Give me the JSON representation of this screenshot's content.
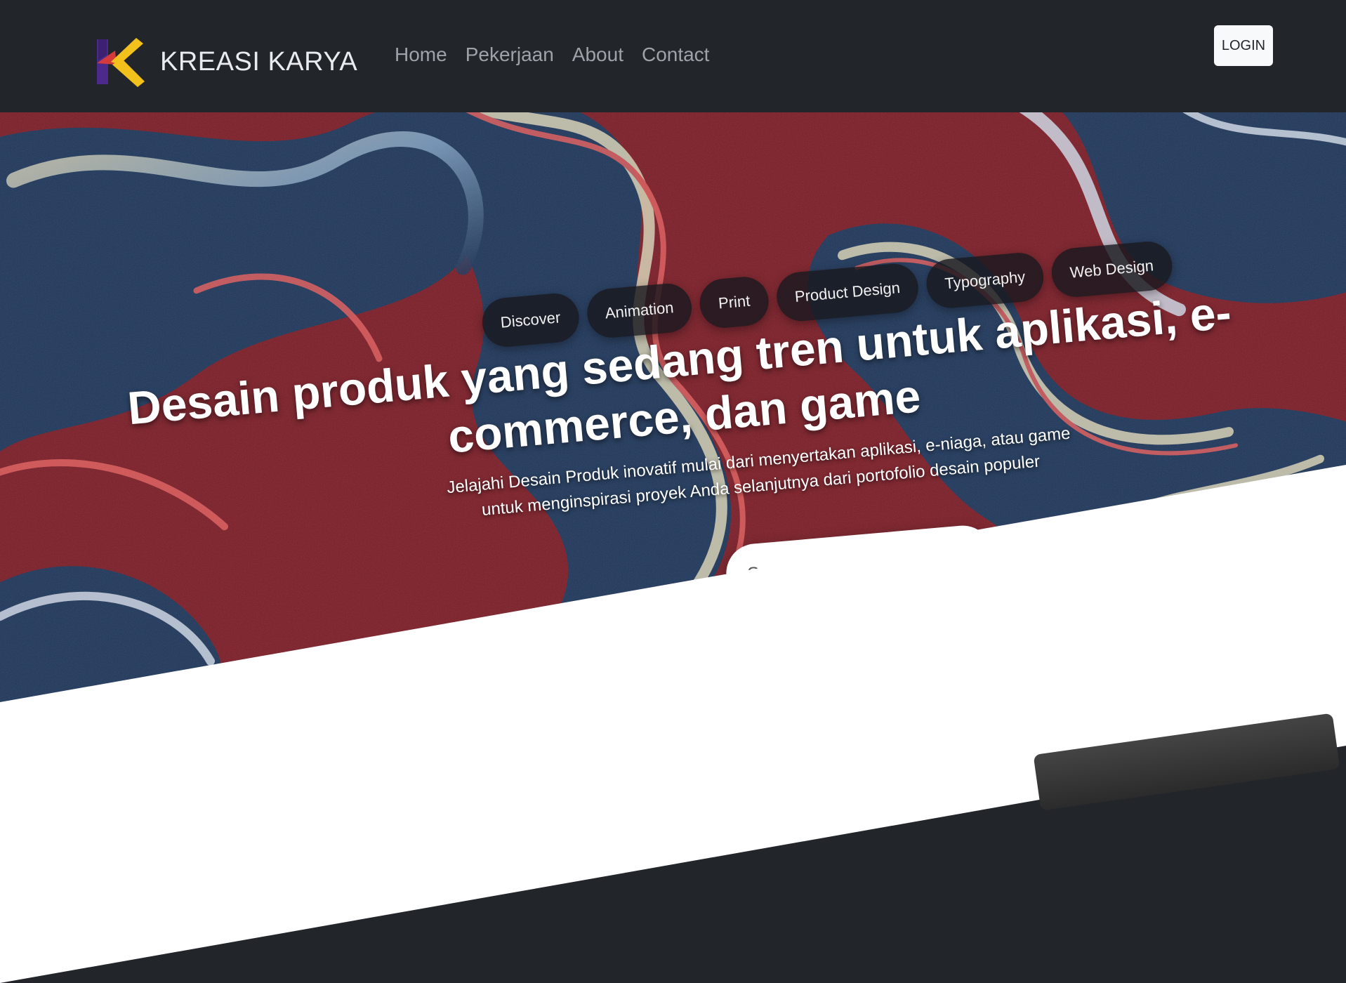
{
  "brand": {
    "name": "KREASI KARYA"
  },
  "nav": {
    "links": [
      {
        "label": "Home"
      },
      {
        "label": "Pekerjaan"
      },
      {
        "label": "About"
      },
      {
        "label": "Contact"
      }
    ],
    "login_label": "LOGIN"
  },
  "hero": {
    "chips": [
      {
        "label": "Discover"
      },
      {
        "label": "Animation"
      },
      {
        "label": "Print"
      },
      {
        "label": "Product Design"
      },
      {
        "label": "Typography"
      },
      {
        "label": "Web Design"
      }
    ],
    "title": "Desain produk yang sedang tren untuk aplikasi, e-commerce, dan game",
    "subtitle": "Jelajahi Desain Produk inovatif mulai dari menyertakan aplikasi, e-niaga, atau game untuk menginspirasi proyek Anda selanjutnya dari portofolio desain populer",
    "search_placeholder": "Search..."
  },
  "colors": {
    "navbar_bg": "#22252a",
    "hero_red": "#7a1b25",
    "hero_navy": "#1d3559",
    "logo_yellow": "#f3c11b",
    "logo_purple": "#4b2a8c",
    "logo_red": "#d43a3a"
  },
  "icons": {
    "logo": "kreasi-karya-k-logo-icon"
  }
}
